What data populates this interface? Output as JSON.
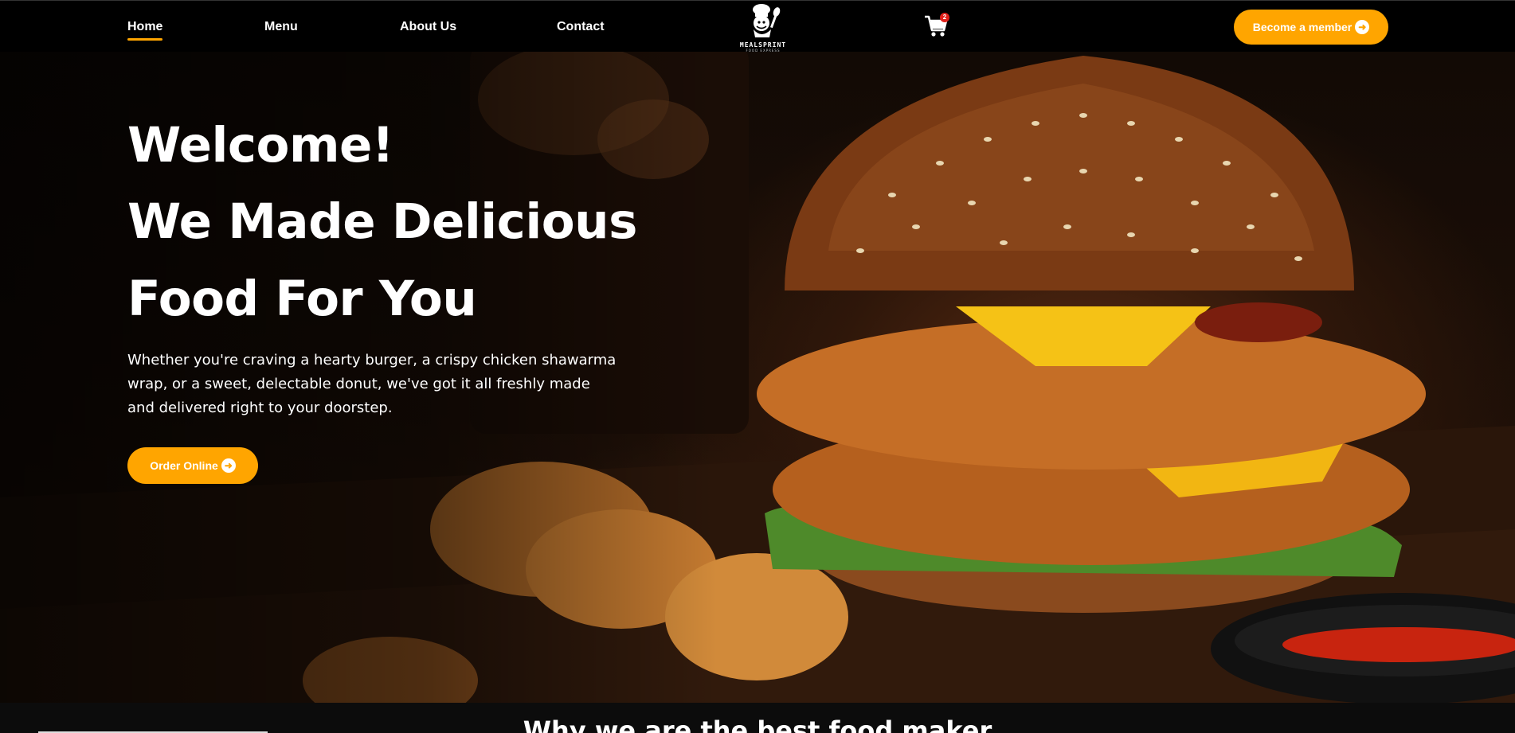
{
  "nav": {
    "items": [
      {
        "label": "Home",
        "active": true
      },
      {
        "label": "Menu"
      },
      {
        "label": "About Us"
      },
      {
        "label": "Contact"
      }
    ],
    "logo": {
      "text": "MEALSPRINT",
      "subtext": "FOOD EXPRESS"
    },
    "cart": {
      "icon": "cart-icon",
      "count": "2"
    },
    "member_button": {
      "label": "Become a member",
      "icon": "arrow-right-circle-icon"
    }
  },
  "hero": {
    "headline": [
      "Welcome!",
      "We Made Delicious",
      "Food For You"
    ],
    "tagline": "Whether you're craving a hearty burger, a crispy chicken shawarma wrap, or a sweet, delectable donut, we've got it all freshly made and delivered right to your doorstep.",
    "order_button": {
      "label": "Order Online",
      "icon": "arrow-right-circle-icon"
    },
    "image": "burger-photo"
  },
  "section": {
    "title": "Why we are the best food maker"
  },
  "colors": {
    "accent": "#ffa500",
    "nav_bg": "#000000",
    "badge": "#e0201a"
  }
}
